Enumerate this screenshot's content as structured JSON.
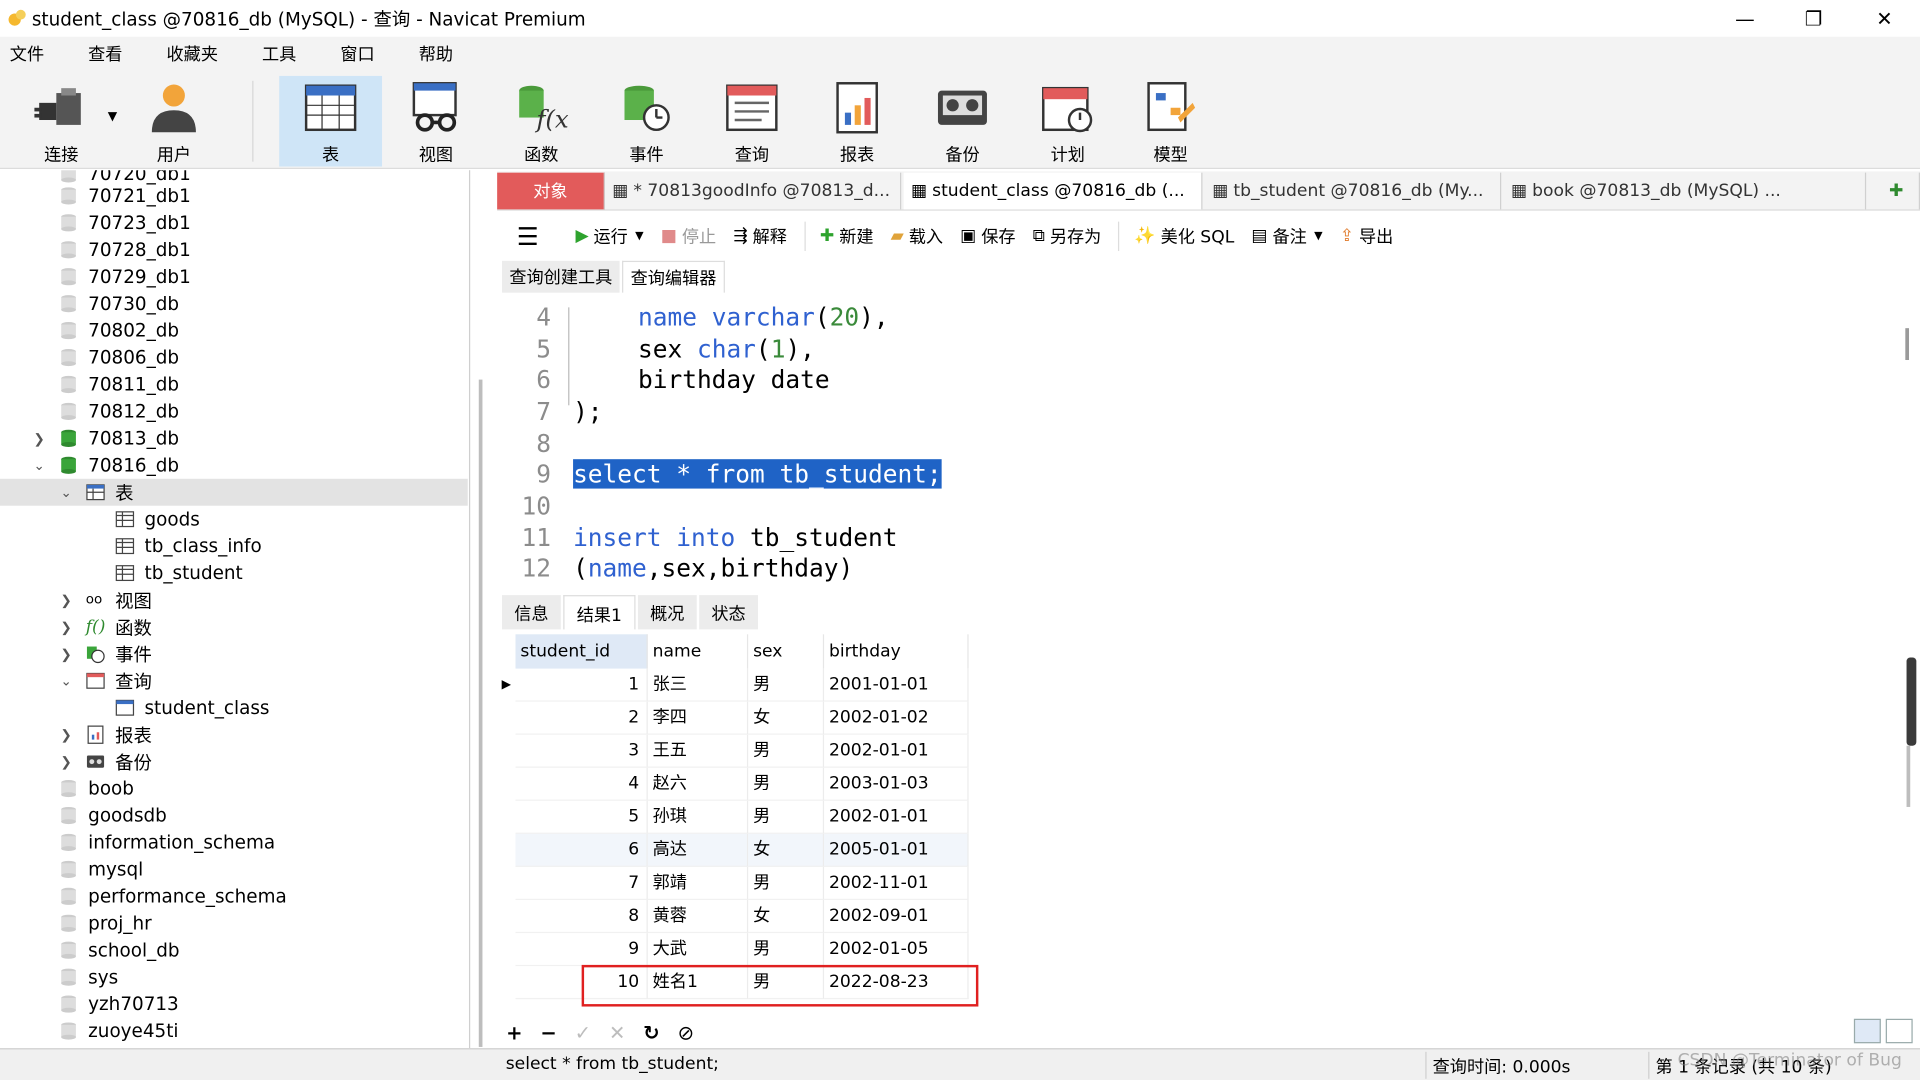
{
  "window": {
    "title": "student_class @70816_db (MySQL) - 查询 - Navicat Premium",
    "minimize_glyph": "—",
    "restore_glyph": "❐",
    "close_glyph": "✕"
  },
  "menu": [
    "文件",
    "查看",
    "收藏夹",
    "工具",
    "窗口",
    "帮助"
  ],
  "toolbar": {
    "connect": "连接",
    "user": "用户",
    "table": "表",
    "view": "视图",
    "function": "函数",
    "event": "事件",
    "query": "查询",
    "report": "报表",
    "backup": "备份",
    "schedule": "计划",
    "model": "模型"
  },
  "tree": {
    "top_partial": "70720_db1",
    "dbs_before": [
      "70721_db1",
      "70723_db1",
      "70728_db1",
      "70729_db1",
      "70730_db",
      "70802_db",
      "70806_db",
      "70811_db",
      "70812_db"
    ],
    "db_70813": "70813_db",
    "db_70816": "70816_db",
    "tables_label": "表",
    "tables": [
      "goods",
      "tb_class_info",
      "tb_student"
    ],
    "views_label": "视图",
    "functions_label": "函数",
    "events_label": "事件",
    "queries_label": "查询",
    "query_item": "student_class",
    "reports_label": "报表",
    "backups_label": "备份",
    "dbs_after": [
      "boob",
      "goodsdb",
      "information_schema",
      "mysql",
      "performance_schema",
      "proj_hr",
      "school_db",
      "sys",
      "yzh70713",
      "zuoye45ti"
    ]
  },
  "tabs": {
    "objects": "对象",
    "t1": "* 70813goodInfo @70813_d...",
    "t2": "student_class @70816_db (...",
    "t3": "tb_student @70816_db (My...",
    "t4": "book @70813_db (MySQL) ..."
  },
  "query_toolbar": {
    "run": "运行",
    "stop": "停止",
    "explain": "解释",
    "new": "新建",
    "load": "载入",
    "save": "保存",
    "save_as": "另存为",
    "beautify": "美化 SQL",
    "comment": "备注",
    "export": "导出"
  },
  "subtabs": {
    "builder": "查询创建工具",
    "editor": "查询编辑器"
  },
  "editor": {
    "line_numbers": [
      "4",
      "5",
      "6",
      "7",
      "8",
      "9",
      "10",
      "11",
      "12"
    ],
    "l4_kw1": "name",
    "l4_kw2": "varchar",
    "l4_p1": "(",
    "l4_n": "20",
    "l4_p2": "),",
    "l5_a": "sex",
    "l5_kw": "char",
    "l5_p1": "(",
    "l5_n": "1",
    "l5_p2": "),",
    "l6": "birthday date",
    "l7": ");",
    "l9": "select * from tb_student;",
    "l11_kw1": "insert",
    "l11_kw2": "into",
    "l11_rest": "tb_student",
    "l12_p1": "(",
    "l12_kw": "name",
    "l12_rest": ",sex,birthday)"
  },
  "result_tabs": {
    "info": "信息",
    "result1": "结果1",
    "overview": "概况",
    "status": "状态"
  },
  "grid": {
    "columns": [
      "student_id",
      "name",
      "sex",
      "birthday"
    ],
    "rows": [
      [
        "1",
        "张三",
        "男",
        "2001-01-01"
      ],
      [
        "2",
        "李四",
        "女",
        "2002-01-02"
      ],
      [
        "3",
        "王五",
        "男",
        "2002-01-01"
      ],
      [
        "4",
        "赵六",
        "男",
        "2003-01-03"
      ],
      [
        "5",
        "孙琪",
        "男",
        "2002-01-01"
      ],
      [
        "6",
        "高达",
        "女",
        "2005-01-01"
      ],
      [
        "7",
        "郭靖",
        "男",
        "2002-11-01"
      ],
      [
        "8",
        "黄蓉",
        "女",
        "2002-09-01"
      ],
      [
        "9",
        "大武",
        "男",
        "2002-01-05"
      ],
      [
        "10",
        "姓名1",
        "男",
        "2022-08-23"
      ]
    ]
  },
  "grid_toolbar": {
    "add": "+",
    "remove": "−",
    "apply": "✓",
    "discard": "✕",
    "refresh": "↻",
    "stop": "⊘"
  },
  "status": {
    "sql": "select * from tb_student;",
    "query_time": "查询时间: 0.000s",
    "records": "第 1 条记录 (共 10 条)",
    "watermark": "CSDN @Terminator of Bug"
  },
  "colors": {
    "object_tab": "#e25b5b",
    "selection": "#1f63c6",
    "keyword": "#2f61d0",
    "number": "#3a8a3a",
    "highlight_box": "#e02020"
  }
}
